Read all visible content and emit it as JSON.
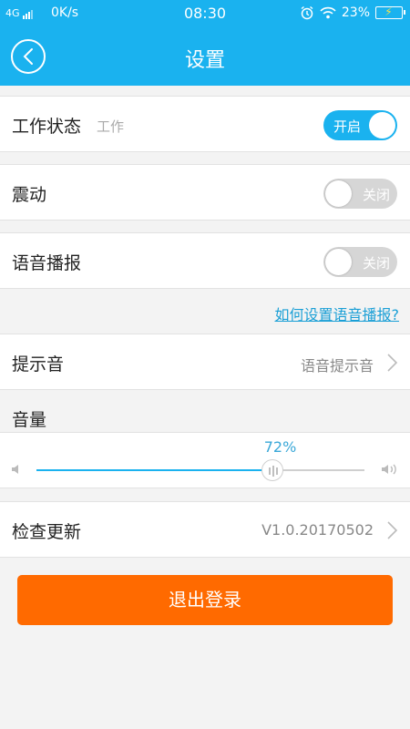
{
  "status_bar": {
    "network": "4G",
    "speed": "0K/s",
    "time": "08:30",
    "battery": "23%",
    "icons": [
      "signal-icon",
      "alarm-icon",
      "wifi-icon",
      "battery-icon"
    ]
  },
  "header": {
    "title": "设置",
    "background": "#1ab2ef"
  },
  "settings": {
    "work_status": {
      "label": "工作状态",
      "sub": "工作",
      "state": "开启",
      "on": true
    },
    "vibrate": {
      "label": "震动",
      "state": "关闭",
      "on": false
    },
    "voice_broadcast": {
      "label": "语音播报",
      "state": "关闭",
      "on": false
    },
    "help_link": "如何设置语音播报?",
    "tone": {
      "label": "提示音",
      "value": "语音提示音"
    },
    "volume": {
      "label": "音量",
      "percent_label": "72%",
      "level": 0.72
    },
    "check_update": {
      "label": "检查更新",
      "value": "V1.0.20170502"
    }
  },
  "logout": {
    "label": "退出登录",
    "color": "#ff6a00"
  }
}
